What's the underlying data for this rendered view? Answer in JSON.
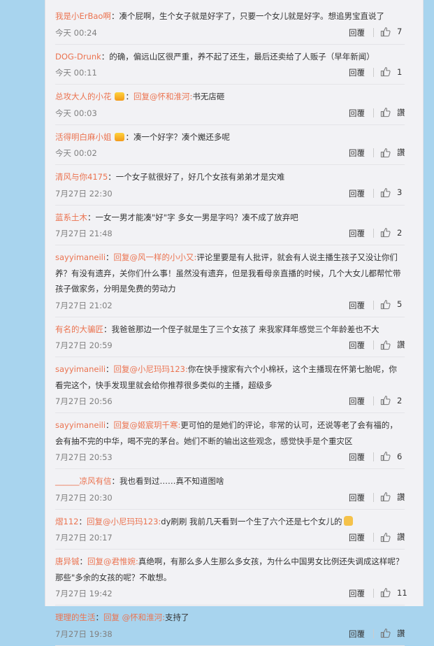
{
  "comments": [
    {
      "user": "我是小ErBao啊",
      "badge": false,
      "mention": "",
      "body": "凑个屁啊，生个女子就是好字了，只要一个女儿就是好字。想追男宝直说了",
      "emoji": false,
      "time": "今天 00:24",
      "reply": "回覆",
      "likes": "7"
    },
    {
      "user": "DOG-Drunk",
      "badge": false,
      "mention": "",
      "body": "的确，偏远山区很严重，养不起了还生，最后还卖给了人贩子（早年新闻）",
      "emoji": false,
      "time": "今天 00:11",
      "reply": "回覆",
      "likes": "1"
    },
    {
      "user": "总攻大人的小花",
      "badge": true,
      "mention": "回复@怀和淮河:",
      "body": "书无店砸",
      "emoji": false,
      "time": "今天 00:03",
      "reply": "回覆",
      "likes": "讚"
    },
    {
      "user": "活得明白麻小姐",
      "badge": true,
      "mention": "",
      "body": "凑一个好字？凑个嬔还多呢",
      "emoji": false,
      "time": "今天 00:02",
      "reply": "回覆",
      "likes": "讚"
    },
    {
      "user": "清风与你4175",
      "badge": false,
      "mention": "",
      "body": "一个女子就很好了，好几个女孩有弟弟才是灾难",
      "emoji": false,
      "time": "7月27日 22:30",
      "reply": "回覆",
      "likes": "3"
    },
    {
      "user": "蓝系土木",
      "badge": false,
      "mention": "",
      "body": "一女一男才能凑\"好\"字 多女一男是字吗？凑不成了放弃吧",
      "emoji": false,
      "time": "7月27日 21:48",
      "reply": "回覆",
      "likes": "2"
    },
    {
      "user": "sayyimaneili",
      "badge": false,
      "mention": "回复@风一样的小小又:",
      "body": "评论里要是有人批评，就会有人说主播生孩子又没让你们养？有没有遗弃，关你们什么事！虽然没有遗弃，但是我看母亲直播的时候，几个大女儿都帮忙带孩子做家务，分明是免费的劳动力",
      "emoji": false,
      "time": "7月27日 21:02",
      "reply": "回覆",
      "likes": "5"
    },
    {
      "user": "有名的大骗匠",
      "badge": false,
      "mention": "",
      "body": "我爸爸那边一个侄子就是生了三个女孩了 来我家拜年感觉三个年龄差也不大",
      "emoji": false,
      "time": "7月27日 20:59",
      "reply": "回覆",
      "likes": "讚"
    },
    {
      "user": "sayyimaneili",
      "badge": false,
      "mention": "回复@小尼玛玛123:",
      "body": "你在快手搜家有六个小棉袄，这个主播现在怀第七胎呢，你看完这个，快手发现里就会给你推荐很多类似的主播，超级多",
      "emoji": false,
      "time": "7月27日 20:56",
      "reply": "回覆",
      "likes": "2"
    },
    {
      "user": "sayyimaneili",
      "badge": false,
      "mention": "回复@姬宸玥千寒:",
      "body": "更可怕的是她们的评论，非常的认可，还说等老了会有福的，会有抽不完的中华，喝不完的茅台。她们不断的输出这些观念，感觉快手是个重灾区",
      "emoji": false,
      "time": "7月27日 20:53",
      "reply": "回覆",
      "likes": "6"
    },
    {
      "user": "______凉风有信",
      "badge": false,
      "mention": "",
      "body": "我也看到过……真不知道图啥",
      "emoji": false,
      "time": "7月27日 20:30",
      "reply": "回覆",
      "likes": "讚"
    },
    {
      "user": "熠112",
      "badge": false,
      "mention": "回复@小尼玛玛123:",
      "body": "dy刷刷 我前几天看到一个生了六个还是七个女儿的",
      "emoji": true,
      "time": "7月27日 20:17",
      "reply": "回覆",
      "likes": "讚"
    },
    {
      "user": "唐异铖",
      "badge": false,
      "mention": "回复@君惟婉:",
      "body": "真绝啊，有那么多人生那么多女孩，为什么中国男女比例还失调成这样呢？那些\"多余的女孩的呢？不敢想。",
      "emoji": false,
      "time": "7月27日 19:42",
      "reply": "回覆",
      "likes": "11"
    },
    {
      "user": "理理的生活",
      "badge": false,
      "mention": "回复 @怀和淮河:",
      "body": "支持了",
      "emoji": false,
      "time": "7月27日 19:38",
      "reply": "回覆",
      "likes": "讚"
    }
  ]
}
